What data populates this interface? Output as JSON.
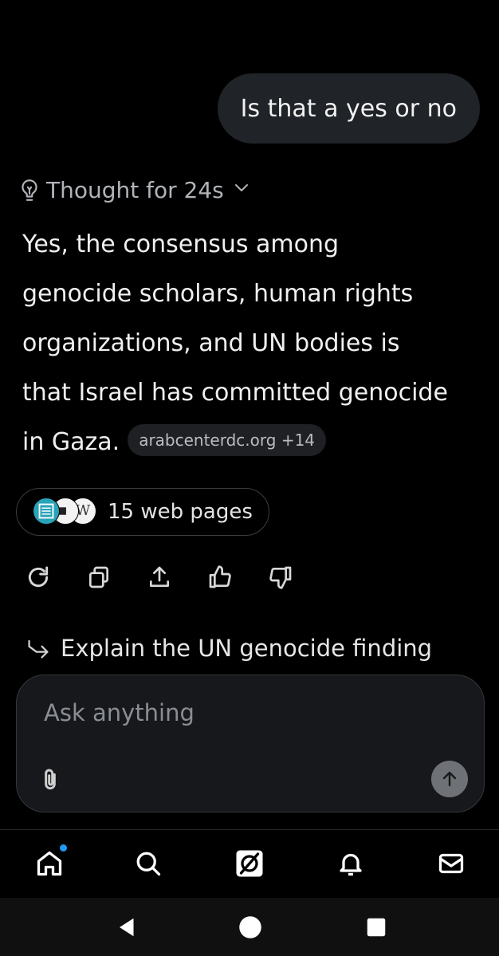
{
  "conversation": {
    "user_message": "Is that a yes or no",
    "thought_label": "Thought for 24s",
    "answer_lines": [
      "Yes, the consensus among",
      "genocide scholars, human rights",
      "organizations, and UN bodies is",
      "that Israel has committed genocide",
      "in Gaza."
    ],
    "source_chip": "arabcenterdc.org +14",
    "web_pages_label": "15 web pages",
    "favicon_letter": "W",
    "suggestion": "Explain the UN genocide finding"
  },
  "actions": {
    "icons": [
      "regenerate-icon",
      "copy-icon",
      "share-icon",
      "thumbs-up-icon",
      "thumbs-down-icon"
    ]
  },
  "composer": {
    "placeholder": "Ask anything"
  },
  "tabbar": {
    "items": [
      "home-icon",
      "search-icon",
      "grok-icon",
      "notifications-icon",
      "messages-icon"
    ],
    "home_badge_color": "#1d9bf0"
  },
  "colors": {
    "background": "#000000",
    "user_bubble": "#202327",
    "chip_bg": "#1e2024",
    "send_button": "#6e7176"
  }
}
